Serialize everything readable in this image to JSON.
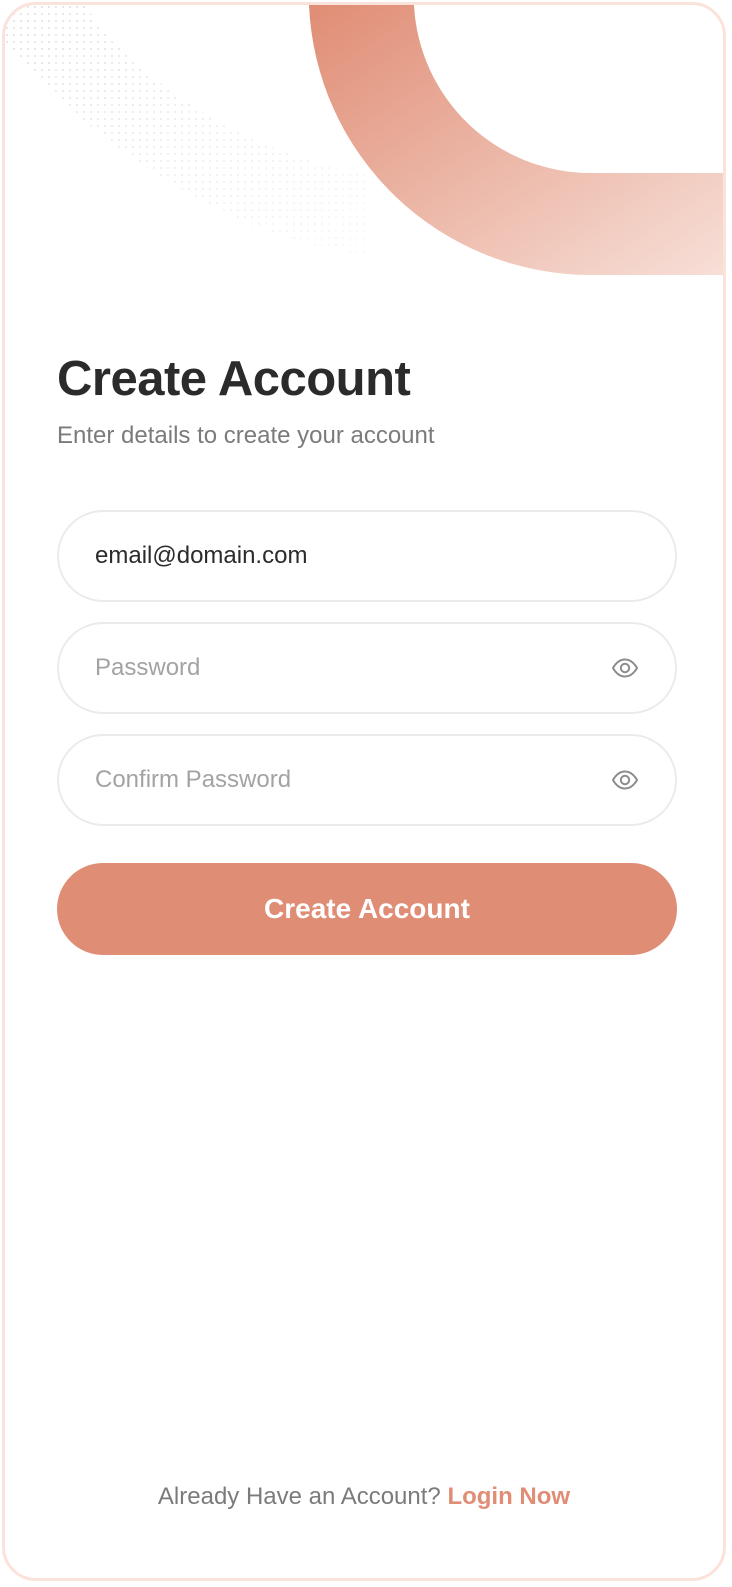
{
  "header": {
    "title": "Create Account",
    "subtitle": "Enter details to create your account"
  },
  "form": {
    "email": {
      "value": "email@domain.com",
      "placeholder": ""
    },
    "password": {
      "value": "",
      "placeholder": "Password",
      "toggle_icon": "eye-icon"
    },
    "confirm_password": {
      "value": "",
      "placeholder": "Confirm Password",
      "toggle_icon": "eye-icon"
    },
    "submit_label": "Create Account"
  },
  "footer": {
    "prompt": "Already Have an Account?",
    "link_label": "Login Now"
  },
  "colors": {
    "accent": "#e08d75",
    "frame_border": "#fbe3dc",
    "title": "#2b2b2b",
    "muted_text": "#7b7b7b",
    "placeholder": "#a3a3a3",
    "field_border": "#ebebeb"
  }
}
